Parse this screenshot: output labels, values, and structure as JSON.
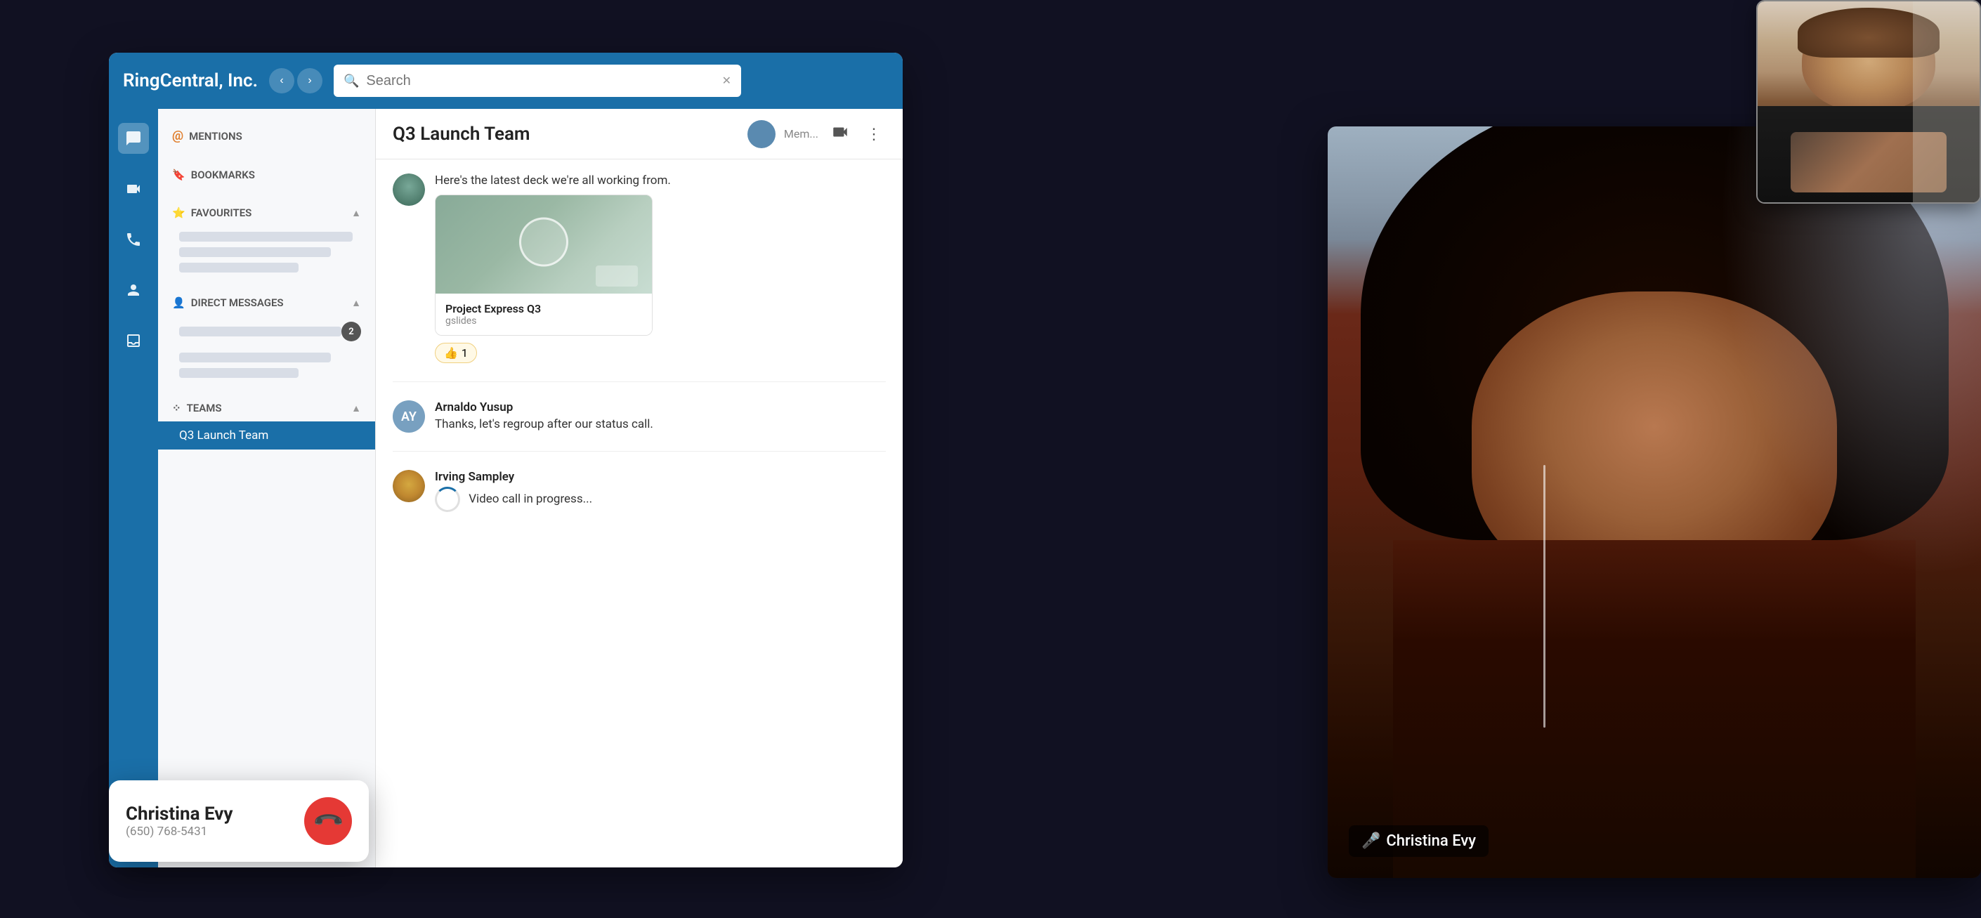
{
  "app": {
    "title": "RingCentral, Inc.",
    "search_placeholder": "Search"
  },
  "sidebar_icons": [
    {
      "name": "chat-icon",
      "symbol": "💬",
      "active": true
    },
    {
      "name": "video-icon",
      "symbol": "📹",
      "active": false
    },
    {
      "name": "phone-icon",
      "symbol": "📞",
      "active": false
    },
    {
      "name": "contacts-icon",
      "symbol": "👤",
      "active": false
    },
    {
      "name": "inbox-icon",
      "symbol": "📥",
      "active": false
    }
  ],
  "nav": {
    "mentions_label": "MENTIONS",
    "bookmarks_label": "BOOKMARKS",
    "favourites_label": "FAVOURITES",
    "direct_messages_label": "DIRECT MESSAGES",
    "teams_label": "TEAMS",
    "active_team": "Q3 Launch Team",
    "dm_badge": "2"
  },
  "chat": {
    "title": "Q3 Launch Team",
    "members_label": "Mem...",
    "messages": [
      {
        "id": "msg1",
        "sender": "",
        "avatar_type": "image",
        "avatar_bg": "#6a9a7a",
        "text": "Here's the latest deck we're all working from.",
        "file": {
          "name": "Project Express Q3",
          "type": "gslides"
        },
        "reaction": "👍 1"
      },
      {
        "id": "msg2",
        "sender": "Arnaldo Yusup",
        "avatar_initials": "AY",
        "avatar_bg": "#78a0c0",
        "text": "Thanks, let's regroup after our status call."
      },
      {
        "id": "msg3",
        "sender": "Irving Sampley",
        "avatar_type": "image",
        "avatar_bg": "#c8a844",
        "text": "Video call in progress..."
      }
    ]
  },
  "video_call": {
    "participant_name": "Christina Evy"
  },
  "incoming_call": {
    "caller_name": "Christina Evy",
    "caller_number": "(650) 768-5431",
    "end_button_label": "End"
  }
}
